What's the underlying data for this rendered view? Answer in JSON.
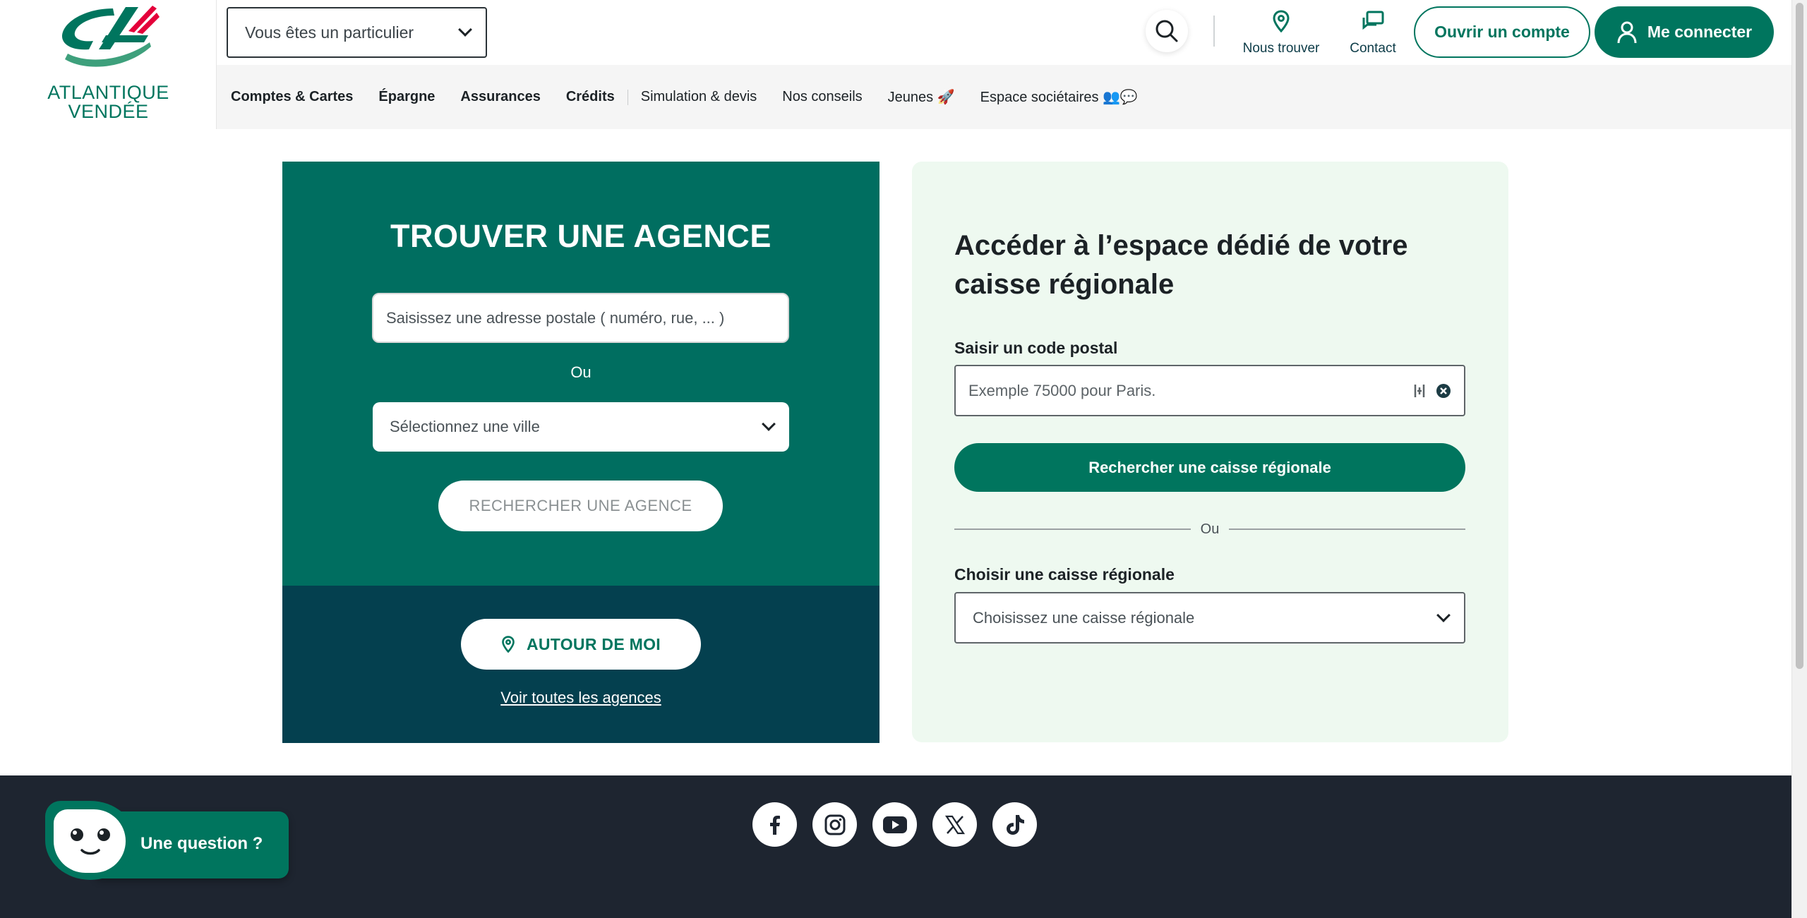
{
  "brand": {
    "name_line1": "ATLANTIQUE",
    "name_line2": "VENDÉE",
    "colors": {
      "primary": "#00755e",
      "dark_teal": "#04404f",
      "accent_red": "#e4003a",
      "footer": "#1e2530"
    }
  },
  "header": {
    "profile_select": {
      "value": "Vous êtes un particulier",
      "icon": "chevron-down-icon"
    },
    "search_icon": "search-icon",
    "links": [
      {
        "label": "Nous trouver",
        "icon": "map-pin-icon"
      },
      {
        "label": "Contact",
        "icon": "chat-bubbles-icon"
      }
    ],
    "open_account_label": "Ouvrir un compte",
    "login_label": "Me connecter",
    "login_icon": "user-icon"
  },
  "nav": {
    "items": [
      {
        "label": "Comptes & Cartes"
      },
      {
        "label": "Épargne"
      },
      {
        "label": "Assurances"
      },
      {
        "label": "Crédits"
      },
      {
        "label": "Simulation & devis"
      },
      {
        "label": "Nos conseils"
      },
      {
        "label": "Jeunes 🚀"
      },
      {
        "label": "Espace sociétaires 👥💬"
      }
    ]
  },
  "find_agency": {
    "title": "TROUVER UNE AGENCE",
    "address_placeholder": "Saisissez une adresse postale ( numéro, rue, ... )",
    "or_label": "Ou",
    "city_select_value": "Sélectionnez une ville",
    "search_button": "RECHERCHER UNE AGENCE",
    "near_me_button": "AUTOUR DE MOI",
    "all_agencies_link": "Voir toutes les agences"
  },
  "regional": {
    "title": "Accéder à l’espace dédié de votre caisse régionale",
    "postal_label": "Saisir un code postal",
    "postal_placeholder": "Exemple 75000 pour Paris.",
    "search_button": "Rechercher une caisse régionale",
    "or_label": "Ou",
    "choose_label": "Choisir une caisse régionale",
    "choose_select_value": "Choisissez une caisse régionale"
  },
  "footer": {
    "socials": [
      "facebook-icon",
      "instagram-icon",
      "youtube-icon",
      "x-icon",
      "tiktok-icon"
    ]
  },
  "chat": {
    "label": "Une question ?"
  }
}
